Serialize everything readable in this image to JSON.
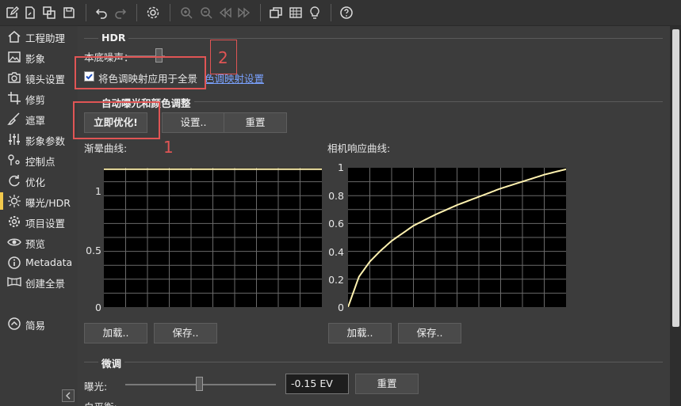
{
  "toolbar": {
    "icons": [
      "new-project-icon",
      "open-file-icon",
      "copy-icon",
      "save-icon",
      "undo-icon",
      "redo-icon",
      "settings-gear-icon",
      "zoom-in-icon",
      "zoom-out-icon",
      "rewind-icon",
      "fast-forward-icon",
      "windows-icon",
      "grid-icon",
      "lightbulb-icon",
      "help-icon"
    ]
  },
  "sidebar": {
    "items": [
      {
        "label": "工程助理",
        "icon": "home-icon"
      },
      {
        "label": "影象",
        "icon": "image-icon"
      },
      {
        "label": "镜头设置",
        "icon": "camera-icon"
      },
      {
        "label": "修剪",
        "icon": "crop-icon"
      },
      {
        "label": "遮罩",
        "icon": "brush-icon"
      },
      {
        "label": "影象参数",
        "icon": "sliders-icon"
      },
      {
        "label": "控制点",
        "icon": "control-points-icon"
      },
      {
        "label": "优化",
        "icon": "optimize-icon"
      },
      {
        "label": "曝光/HDR",
        "icon": "sun-icon"
      },
      {
        "label": "项目设置",
        "icon": "gear-icon"
      },
      {
        "label": "预览",
        "icon": "eye-icon"
      },
      {
        "label": "Metadata",
        "icon": "info-icon"
      },
      {
        "label": "创建全景",
        "icon": "panorama-icon"
      }
    ],
    "simple_label": "简易",
    "active": "曝光/HDR",
    "accent": "#f2c94c"
  },
  "hdr": {
    "title": "HDR",
    "noise_label": "本底噪声：",
    "noise_value": 0.5,
    "apply_label": "将色调映射应用于全景",
    "apply_checked": true,
    "tonemap_link": "色调映射设置"
  },
  "auto": {
    "title": "自动曝光和颜色调整",
    "optimize_label": "立即优化!",
    "settings_label": "设置..",
    "reset_label": "重置"
  },
  "vignette": {
    "label": "渐晕曲线:",
    "ticks": [
      "1",
      "0.5",
      "0"
    ],
    "load_label": "加载..",
    "save_label": "保存.."
  },
  "response": {
    "label": "相机响应曲线:",
    "ticks": [
      "1",
      "0.8",
      "0.6",
      "0.4",
      "0.2",
      "0"
    ],
    "load_label": "加载..",
    "save_label": "保存.."
  },
  "fine": {
    "title": "微调",
    "exposure_label": "曝光:",
    "exposure_value": "-0.15 EV",
    "exposure_level": 0.49,
    "reset_label": "重置",
    "wb_label": "白平衡:"
  },
  "annotations": {
    "one": "1",
    "two": "2",
    "color": "#e05555"
  },
  "chart_data": [
    {
      "type": "line",
      "title": "渐晕曲线:",
      "xlim": [
        0,
        1
      ],
      "ylim": [
        0,
        1
      ],
      "grid": true,
      "series": [
        {
          "x": [
            0,
            1
          ],
          "y": [
            1,
            1
          ],
          "color": "#fff2b0"
        }
      ]
    },
    {
      "type": "line",
      "title": "相机响应曲线:",
      "xlim": [
        0,
        1
      ],
      "ylim": [
        0,
        1
      ],
      "grid": true,
      "series": [
        {
          "x": [
            0,
            0.05,
            0.1,
            0.15,
            0.2,
            0.3,
            0.4,
            0.5,
            0.6,
            0.7,
            0.8,
            0.9,
            1.0
          ],
          "y": [
            0,
            0.22,
            0.33,
            0.41,
            0.48,
            0.59,
            0.67,
            0.74,
            0.8,
            0.86,
            0.91,
            0.96,
            1.0
          ],
          "color": "#fff2b0"
        }
      ]
    }
  ]
}
